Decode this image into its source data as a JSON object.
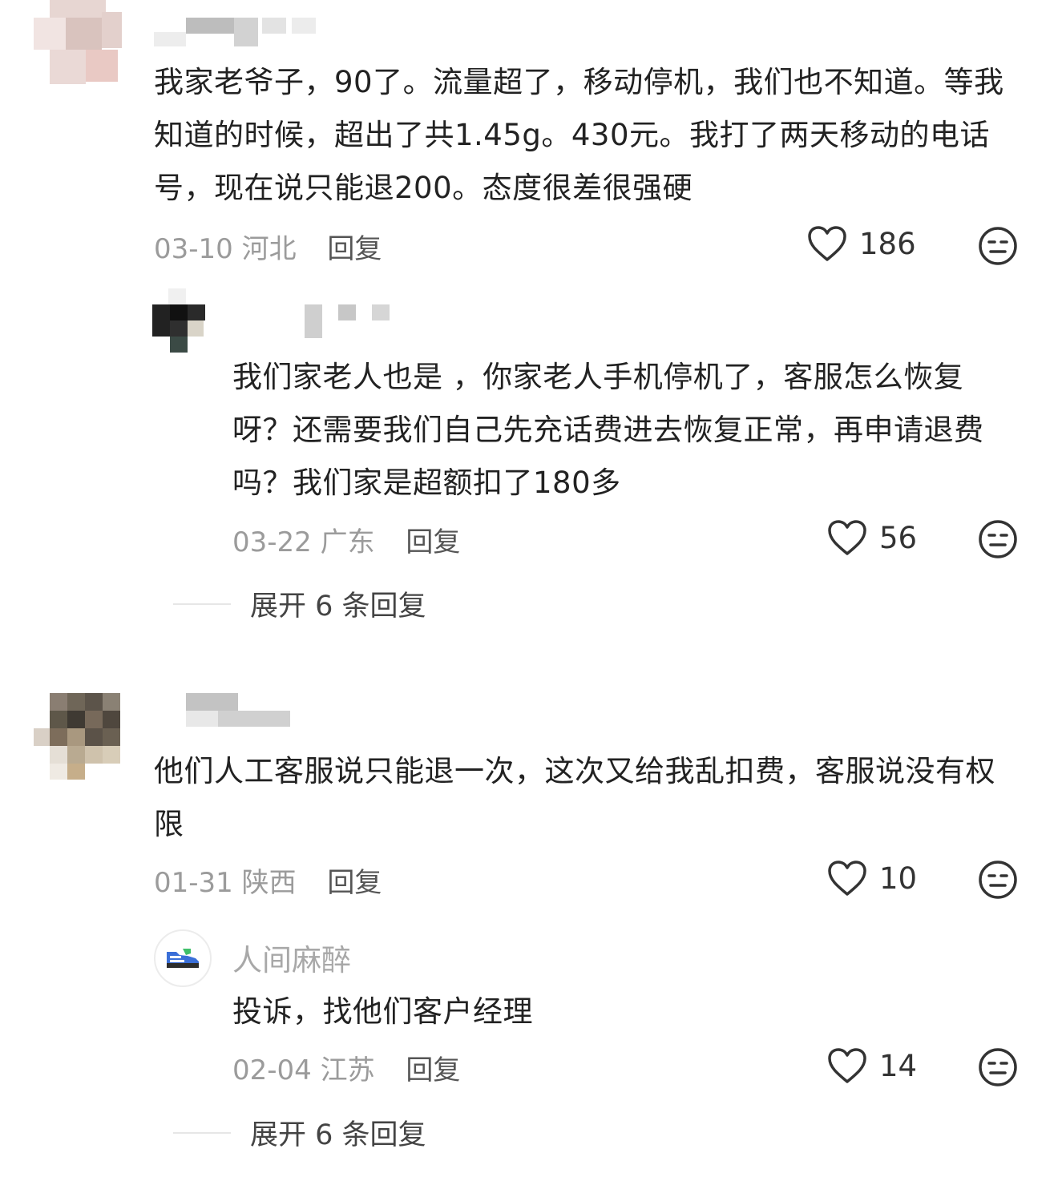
{
  "comments": [
    {
      "text": "我家老爷子，90了。流量超了，移动停机，我们也不知道。等我知道的时候，超出了共1.45g。430元。我打了两天移动的电话号，现在说只能退200。态度很差很强硬",
      "date": "03-10",
      "location": "河北",
      "reply_label": "回复",
      "likes": "186",
      "reply": {
        "text": "我们家老人也是 ，你家老人手机停机了，客服怎么恢复呀？还需要我们自己先充话费进去恢复正常，再申请退费吗？我们家是超额扣了180多",
        "date": "03-22",
        "location": "广东",
        "reply_label": "回复",
        "likes": "56"
      },
      "expand_label": "展开 6 条回复"
    },
    {
      "text": "他们人工客服说只能退一次，这次又给我乱扣费，客服说没有权限",
      "date": "01-31",
      "location": "陕西",
      "reply_label": "回复",
      "likes": "10",
      "reply": {
        "username": "人间麻醉",
        "text": "投诉，找他们客户经理",
        "date": "02-04",
        "location": "江苏",
        "reply_label": "回复",
        "likes": "14"
      },
      "expand_label": "展开 6 条回复"
    }
  ],
  "icons": {
    "like": "heart-outline-icon",
    "dislike": "neutral-face-icon",
    "reply_avatar": "sneaker-icon"
  }
}
